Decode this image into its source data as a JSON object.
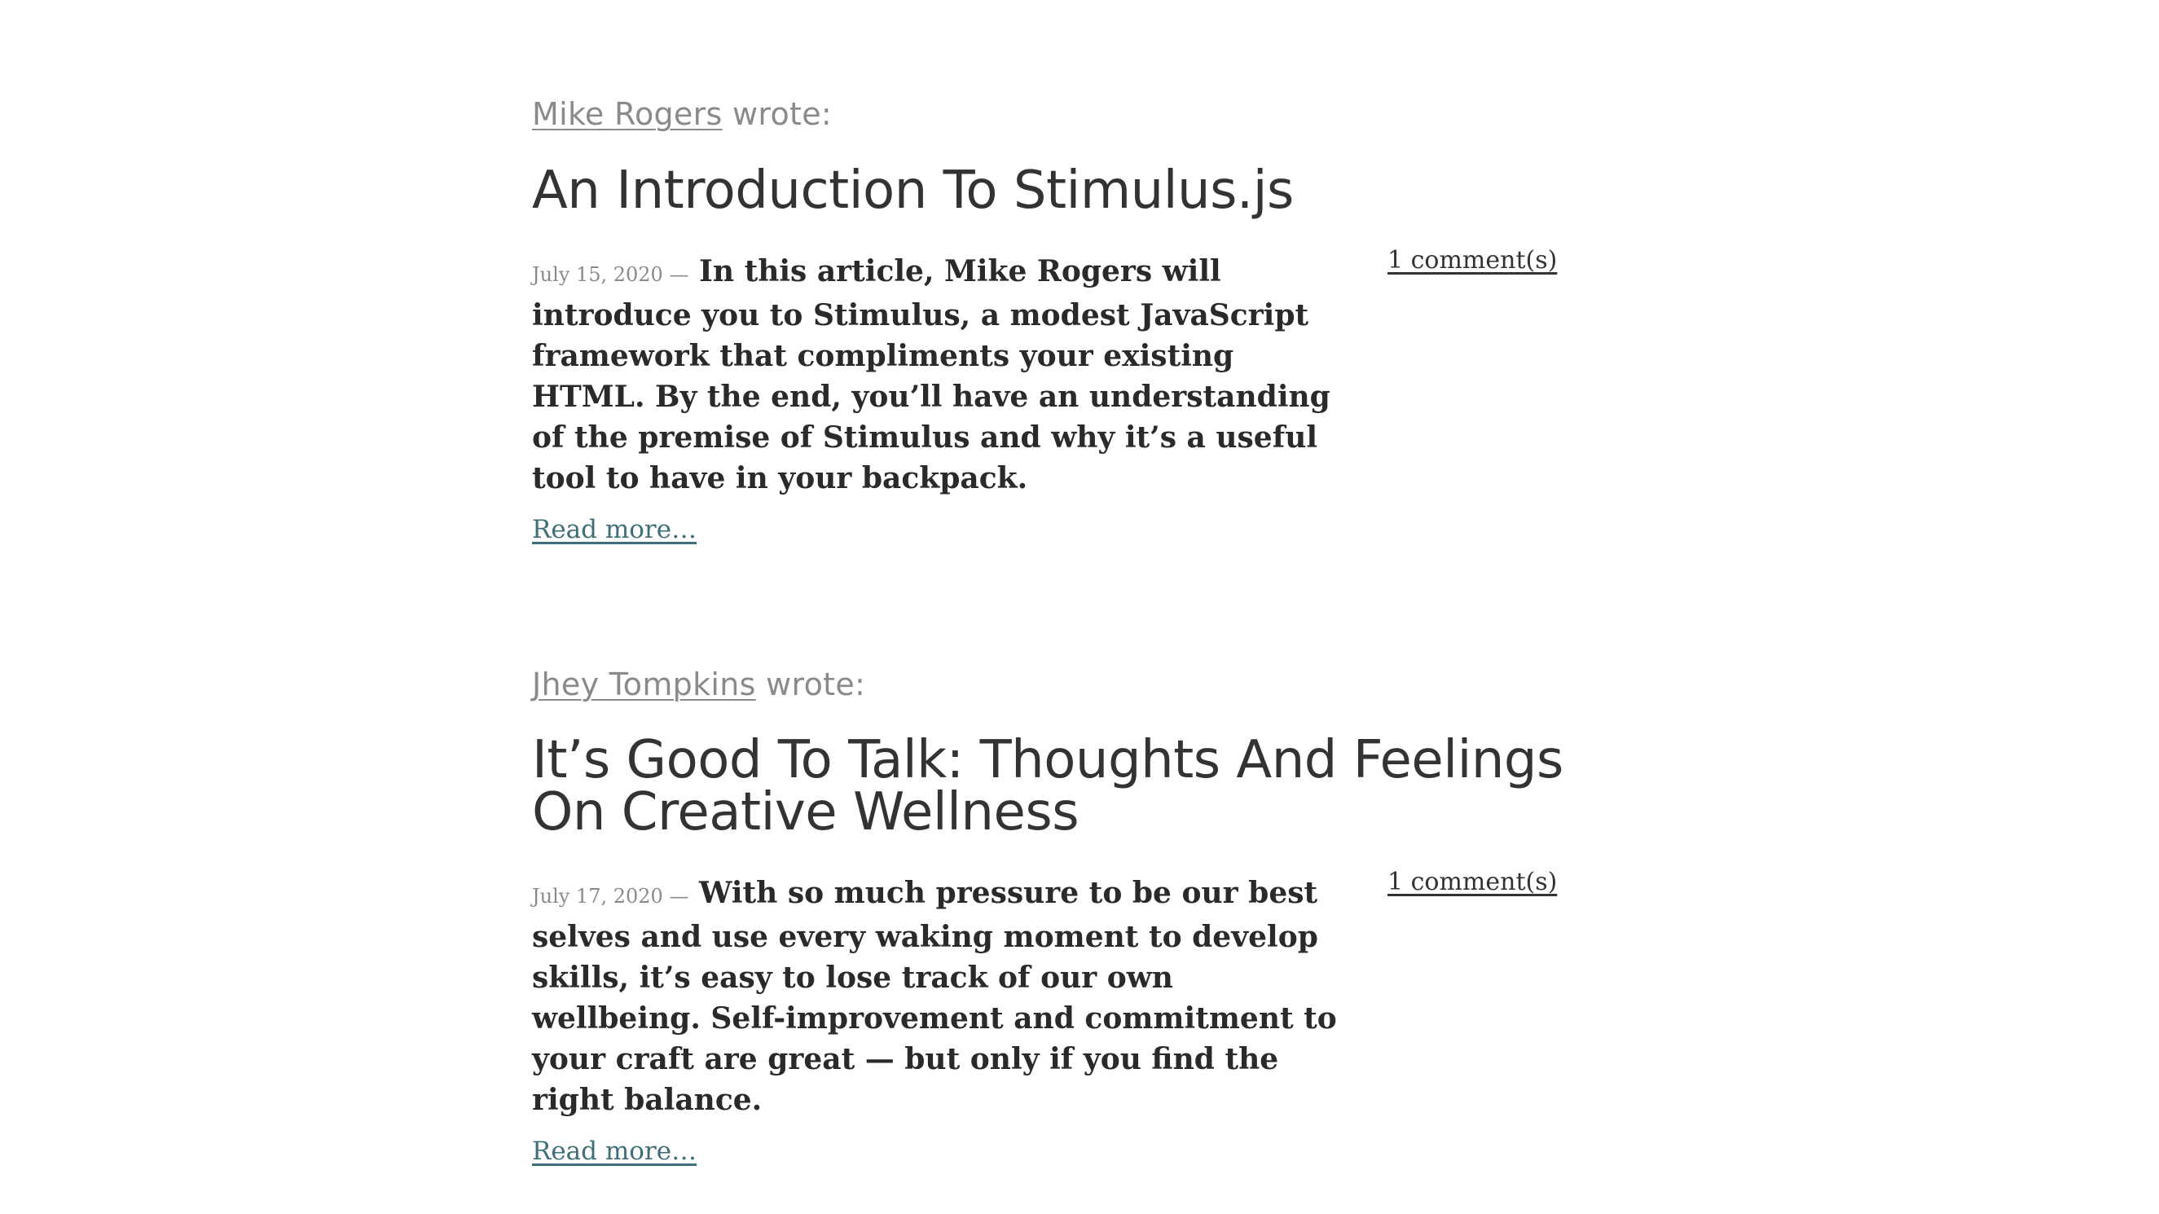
{
  "articles": [
    {
      "author": "Mike Rogers",
      "wrote": "wrote:",
      "title": "An Introduction To Stimulus.js",
      "date": "July 15, 2020",
      "date_separator": "—",
      "excerpt": "In this article, Mike Rogers will introduce you to Stimulus, a modest JavaScript framework that compliments your existing HTML. By the end, you’ll have an understanding of the premise of Stimulus and why it’s a useful tool to have in your backpack.",
      "comments_label": "1 comment(s)",
      "read_more_label": "Read more…"
    },
    {
      "author": "Jhey Tompkins",
      "wrote": "wrote:",
      "title": "It’s Good To Talk: Thoughts And Feelings On Creative Wellness",
      "date": "July 17, 2020",
      "date_separator": "—",
      "excerpt": "With so much pressure to be our best selves and use every waking moment to develop skills, it’s easy to lose track of our own wellbeing. Self-improvement and commitment to your craft are great — but only if you find the right balance.",
      "comments_label": "1 comment(s)",
      "read_more_label": "Read more…"
    }
  ],
  "colors": {
    "byline": "#8a8a8a",
    "title": "#333333",
    "body": "#2a2a2a",
    "link": "#3e6e78"
  }
}
